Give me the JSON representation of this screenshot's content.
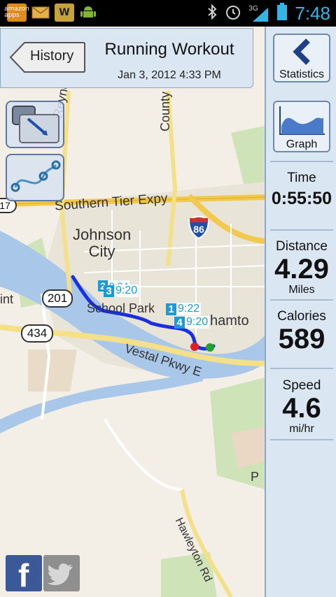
{
  "statusbar": {
    "icons": [
      "amazon-appstore-icon",
      "email-icon",
      "wordfeud-icon",
      "android-icon"
    ],
    "amazon_label": "amazon apps",
    "network_label": "3G",
    "time": "7:48",
    "accent": "#33b5e5"
  },
  "header": {
    "back_label": "History",
    "title": "Running Workout",
    "datetime": "Jan 3, 2012 4:33 PM"
  },
  "sidebar": {
    "statistics_label": "Statistics",
    "graph_label": "Graph",
    "stats": [
      {
        "name": "Time",
        "value": "0:55:50",
        "unit": ""
      },
      {
        "name": "Distance",
        "value": "4.29",
        "unit": "Miles"
      },
      {
        "name": "Calories",
        "value": "589",
        "unit": ""
      },
      {
        "name": "Speed",
        "value": "4.6",
        "unit": "mi/hr"
      }
    ]
  },
  "map": {
    "labels": {
      "reynolds": "Reynolds",
      "county": "County",
      "southern_tier": "Southern Tier Expy",
      "johnson_city": "Johnson\nCity",
      "school_park": "School Park",
      "binghamton": "hamto",
      "vestal": "Vestal Pkwy E",
      "hawleyton": "Hawleyton Rd",
      "int": "int",
      "p": "P"
    },
    "shields": [
      "17",
      "201",
      "434",
      "86"
    ],
    "markers": [
      {
        "num": "2",
        "time": "9:24"
      },
      {
        "num": "3",
        "time": "9:20"
      },
      {
        "num": "1",
        "time": "9:22"
      },
      {
        "num": "4",
        "time": "9:20"
      }
    ],
    "route_color": "#1a2fe0"
  },
  "social": {
    "facebook": "facebook-icon",
    "twitter": "twitter-icon",
    "facebook_letter": "f"
  }
}
